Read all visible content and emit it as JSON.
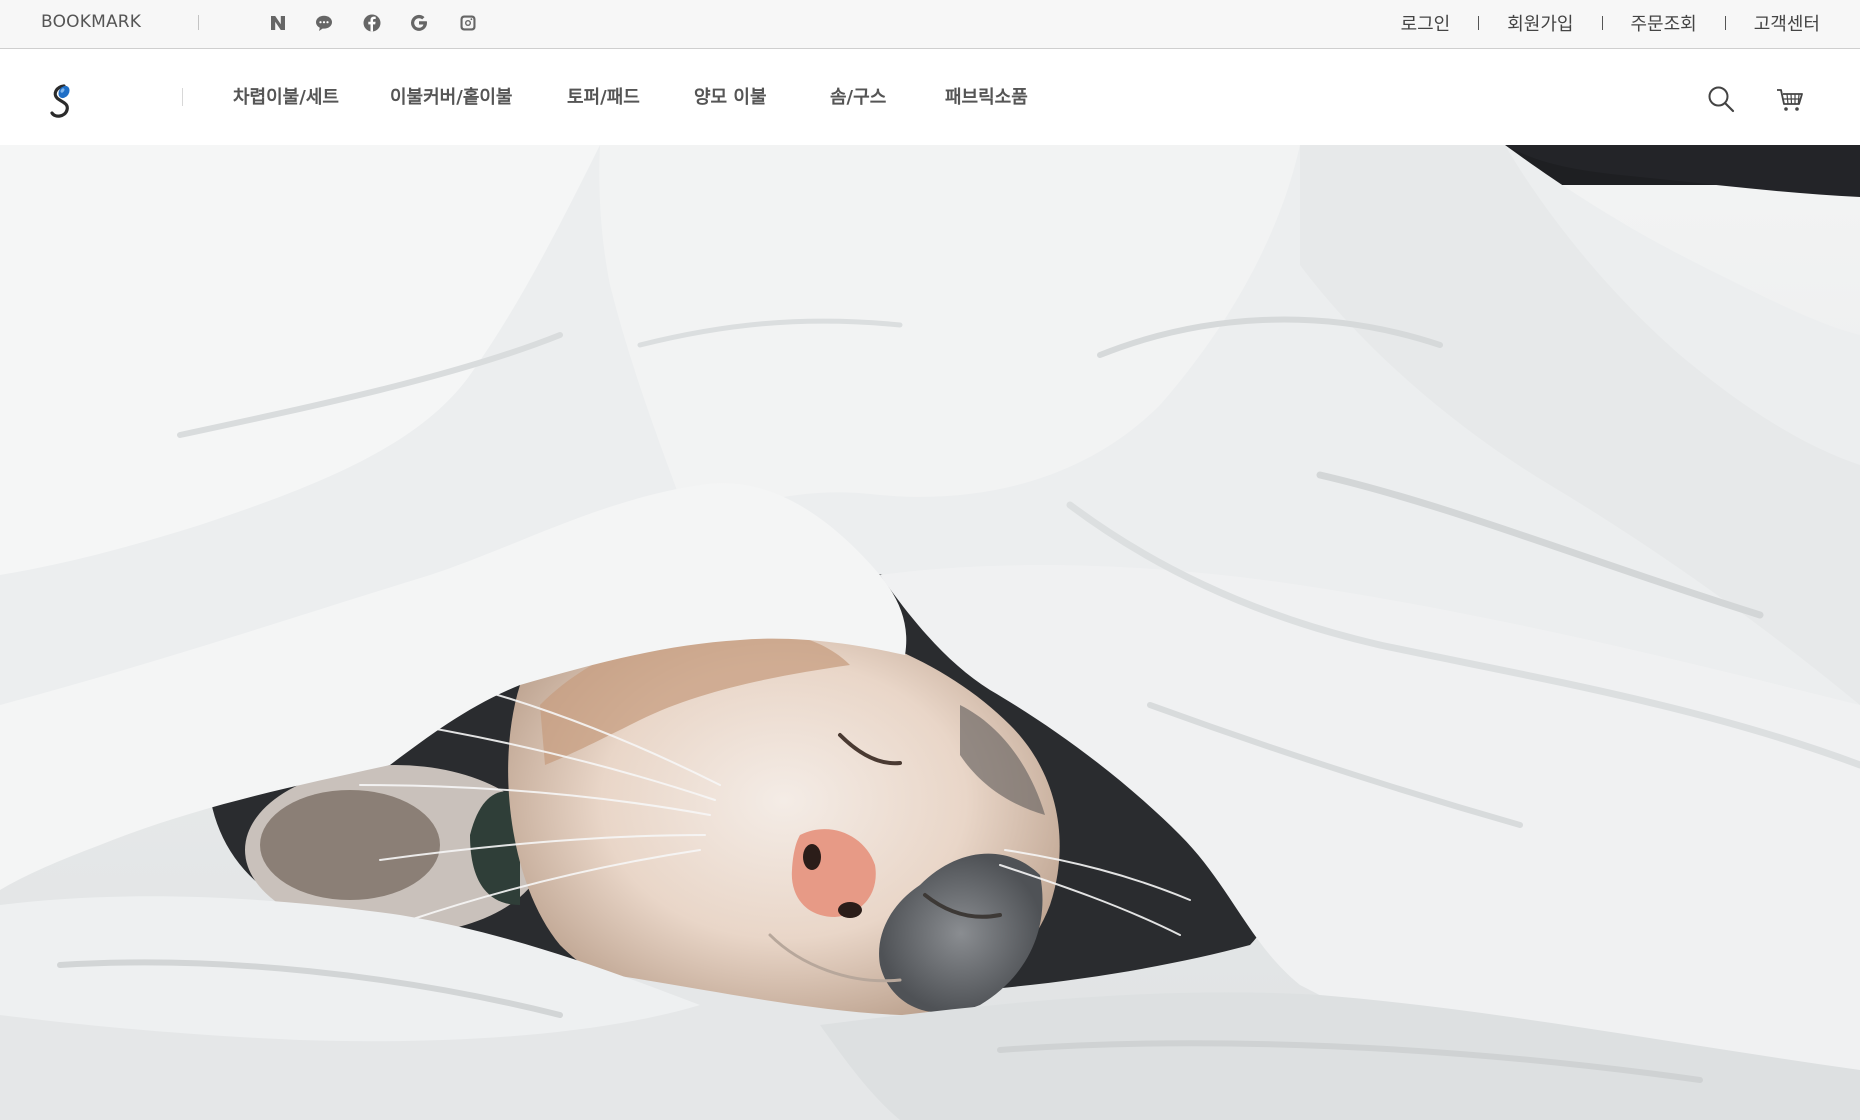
{
  "topbar": {
    "bookmark_label": "BOOKMARK",
    "social_icons": [
      "naver-icon",
      "kakaotalk-icon",
      "facebook-icon",
      "google-icon",
      "instagram-icon"
    ],
    "account_links": [
      "로그인",
      "회원가입",
      "주문조회",
      "고객센터"
    ]
  },
  "header": {
    "logo_name": "brand-logo",
    "nav_items": [
      "차렵이불/세트",
      "이불커버/홑이불",
      "토퍼/패드",
      "양모 이불",
      "솜/구스",
      "패브릭소품"
    ],
    "icons": [
      "search-icon",
      "cart-icon"
    ]
  },
  "hero": {
    "image_subject": "cat sleeping under white duvet"
  },
  "colors": {
    "topbar_bg": "#f7f7f7",
    "text_dark": "#444444",
    "nav_text": "#555555",
    "logo_blue": "#1f6fc7",
    "logo_dark": "#2b2b2b"
  }
}
